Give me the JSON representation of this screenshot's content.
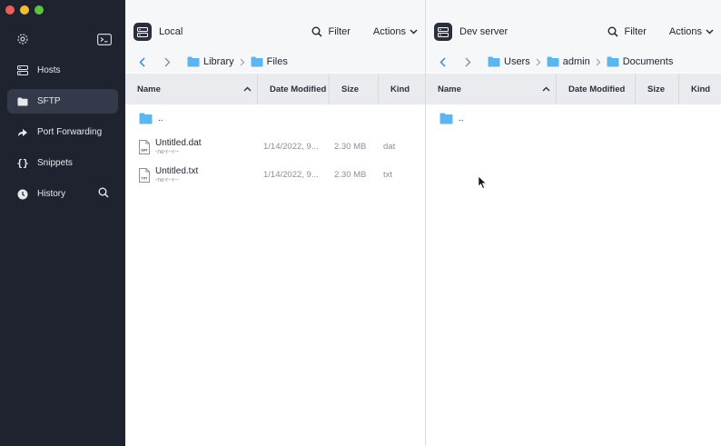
{
  "sidebar": {
    "items": [
      {
        "label": "Hosts",
        "icon": "server-icon"
      },
      {
        "label": "SFTP",
        "icon": "folder-icon",
        "active": true
      },
      {
        "label": "Port Forwarding",
        "icon": "forward-arrow-icon"
      },
      {
        "label": "Snippets",
        "icon": "braces-icon"
      },
      {
        "label": "History",
        "icon": "clock-icon"
      }
    ]
  },
  "left_pane": {
    "title": "Local",
    "filter_label": "Filter",
    "actions_label": "Actions",
    "breadcrumbs": [
      "Library",
      "Files"
    ],
    "columns": [
      "Name",
      "Date Modified",
      "Size",
      "Kind"
    ],
    "parent_label": "..",
    "files": [
      {
        "name": "Untitled.dat",
        "perms": "-rw-r--r--",
        "date": "1/14/2022, 9...",
        "size": "2.30 MB",
        "kind": "dat",
        "icon_text": "DAT"
      },
      {
        "name": "Untitled.txt",
        "perms": "-rw-r--r--",
        "date": "1/14/2022, 9...",
        "size": "2.30 MB",
        "kind": "txt",
        "icon_text": "TXT"
      }
    ]
  },
  "right_pane": {
    "title": "Dev server",
    "filter_label": "Filter",
    "actions_label": "Actions",
    "breadcrumbs": [
      "Users",
      "admin",
      "Documents"
    ],
    "columns": [
      "Name",
      "Date Modified",
      "Size",
      "Kind"
    ],
    "parent_label": ".."
  },
  "colors": {
    "sidebar_bg": "#1f2330",
    "sidebar_active": "#343a4a",
    "folder": "#5bb6f0",
    "nav_accent": "#4a90d9",
    "header_bg": "#e9ebef"
  }
}
